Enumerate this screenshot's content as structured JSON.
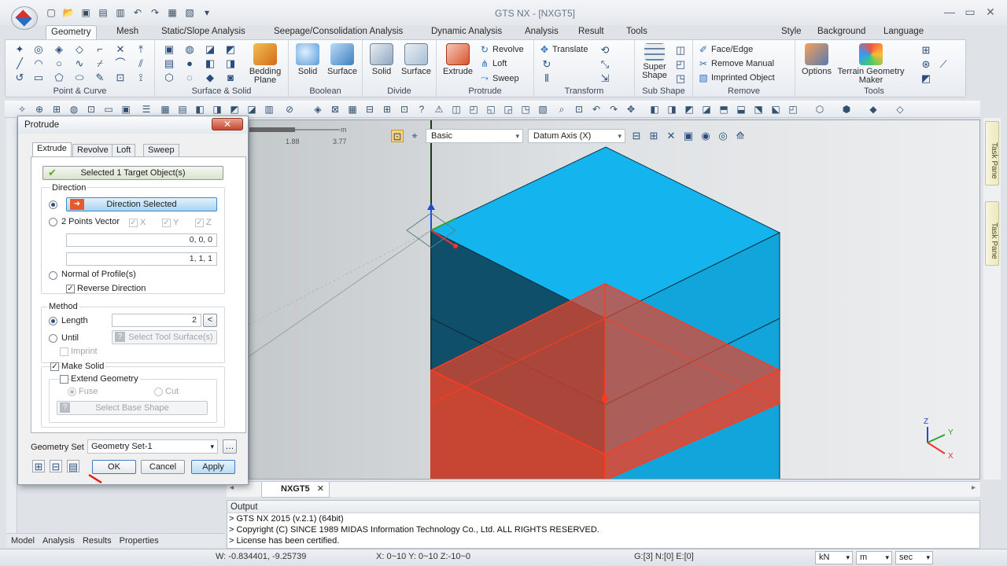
{
  "window": {
    "title": "GTS NX - [NXGT5]",
    "minimize": "—",
    "maximize": "▭",
    "close": "✕"
  },
  "menu_tabs": [
    "Geometry",
    "Mesh",
    "Static/Slope Analysis",
    "Seepage/Consolidation Analysis",
    "Dynamic Analysis",
    "Analysis",
    "Result",
    "Tools"
  ],
  "menu_right": [
    "Style",
    "Background",
    "Language"
  ],
  "ribbon": {
    "groups": {
      "point_curve": "Point & Curve",
      "surface_solid": "Surface & Solid",
      "boolean": "Boolean",
      "divide": "Divide",
      "protrude": "Protrude",
      "transform": "Transform",
      "sub_shape": "Sub Shape",
      "remove": "Remove",
      "tools": "Tools"
    },
    "bedding_plane": "Bedding Plane",
    "boolean_solid": "Solid",
    "boolean_surface": "Surface",
    "divide_solid": "Solid",
    "divide_surface": "Surface",
    "extrude": "Extrude",
    "revolve": "Revolve",
    "loft": "Loft",
    "sweep": "Sweep",
    "translate": "Translate",
    "super_shape": "Super Shape",
    "face_edge": "Face/Edge",
    "remove_manual": "Remove Manual",
    "imprinted_object": "Imprinted Object",
    "options": "Options",
    "terrain_geometry_maker": "Terrain Geometry Maker"
  },
  "viewport": {
    "display_mode": "Basic",
    "datum": "Datum Axis (X)",
    "ruler_ticks": [
      "1.88",
      "3.77"
    ],
    "ruler_unit": "m",
    "axis_labels": {
      "z": "Z",
      "y": "Y",
      "x": "X"
    }
  },
  "task_pane": [
    "Task Pane",
    "Task Pane"
  ],
  "document_tab": "NXGT5",
  "output": {
    "title": "Output",
    "lines": [
      "> GTS NX 2015 (v.2.1) (64bit)",
      "> Copyright (C) SINCE 1989 MIDAS Information Technology Co., Ltd. ALL RIGHTS RESERVED.",
      "> License has been certified."
    ]
  },
  "left_tabs": [
    "Model",
    "Analysis",
    "Results",
    "Properties"
  ],
  "status": {
    "w": "W: -0.834401, -9.25739",
    "range": "X: 0~10 Y: 0~10 Z:-10~0",
    "counts": "G:[3] N:[0] E:[0]",
    "units": [
      "kN",
      "m",
      "sec"
    ]
  },
  "dialog": {
    "title": "Protrude",
    "tabs": [
      "Extrude",
      "Revolve",
      "Loft",
      "Sweep"
    ],
    "selected_button": "Selected 1 Target Object(s)",
    "direction_label": "Direction",
    "direction_selected": "Direction Selected",
    "two_points_vector": "2 Points Vector",
    "x": "X",
    "y": "Y",
    "z": "Z",
    "vector1": "0, 0, 0",
    "vector2": "1, 1, 1",
    "normal_of_profiles": "Normal of Profile(s)",
    "reverse_direction": "Reverse Direction",
    "method_label": "Method",
    "length_label": "Length",
    "length_value": "2",
    "until_label": "Until",
    "select_tool_surfaces": "Select Tool Surface(s)",
    "imprint": "Imprint",
    "make_solid": "Make Solid",
    "extend_geometry": "Extend Geometry",
    "fuse": "Fuse",
    "cut": "Cut",
    "select_base_shape": "Select Base Shape",
    "geometry_set_label": "Geometry Set",
    "geometry_set_value": "Geometry Set-1",
    "ok": "OK",
    "cancel": "Cancel",
    "apply": "Apply"
  },
  "colors": {
    "top_face": "#14b4ee",
    "front_face": "#0f4f69",
    "protrusion": "#e8432a",
    "accent": "#2f6dbd"
  }
}
